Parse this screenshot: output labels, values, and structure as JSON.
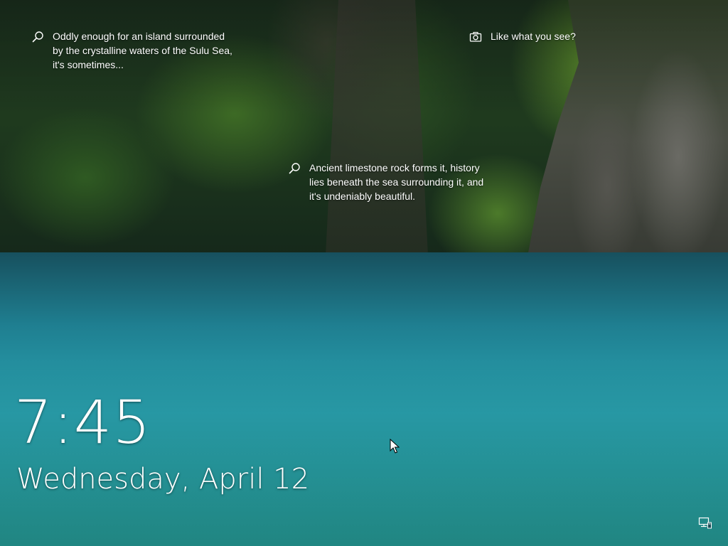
{
  "lockscreen": {
    "spotlight": {
      "top_left": {
        "icon": "search-icon",
        "text": "Oddly enough for an island surrounded\nby the crystalline waters of the Sulu Sea,\nit's sometimes..."
      },
      "center": {
        "icon": "search-icon",
        "text": "Ancient limestone rock forms it, history\nlies beneath the sea surrounding it, and\nit's undeniably beautiful."
      },
      "top_right": {
        "icon": "camera-icon",
        "text": "Like what you see?"
      }
    },
    "clock": {
      "time": "7:45",
      "date": "Wednesday, April 12"
    },
    "status": {
      "network_icon": "network-icon"
    }
  },
  "colors": {
    "text": "#ffffff",
    "water": "#2aa3b0",
    "foliage": "#2f5a22"
  }
}
